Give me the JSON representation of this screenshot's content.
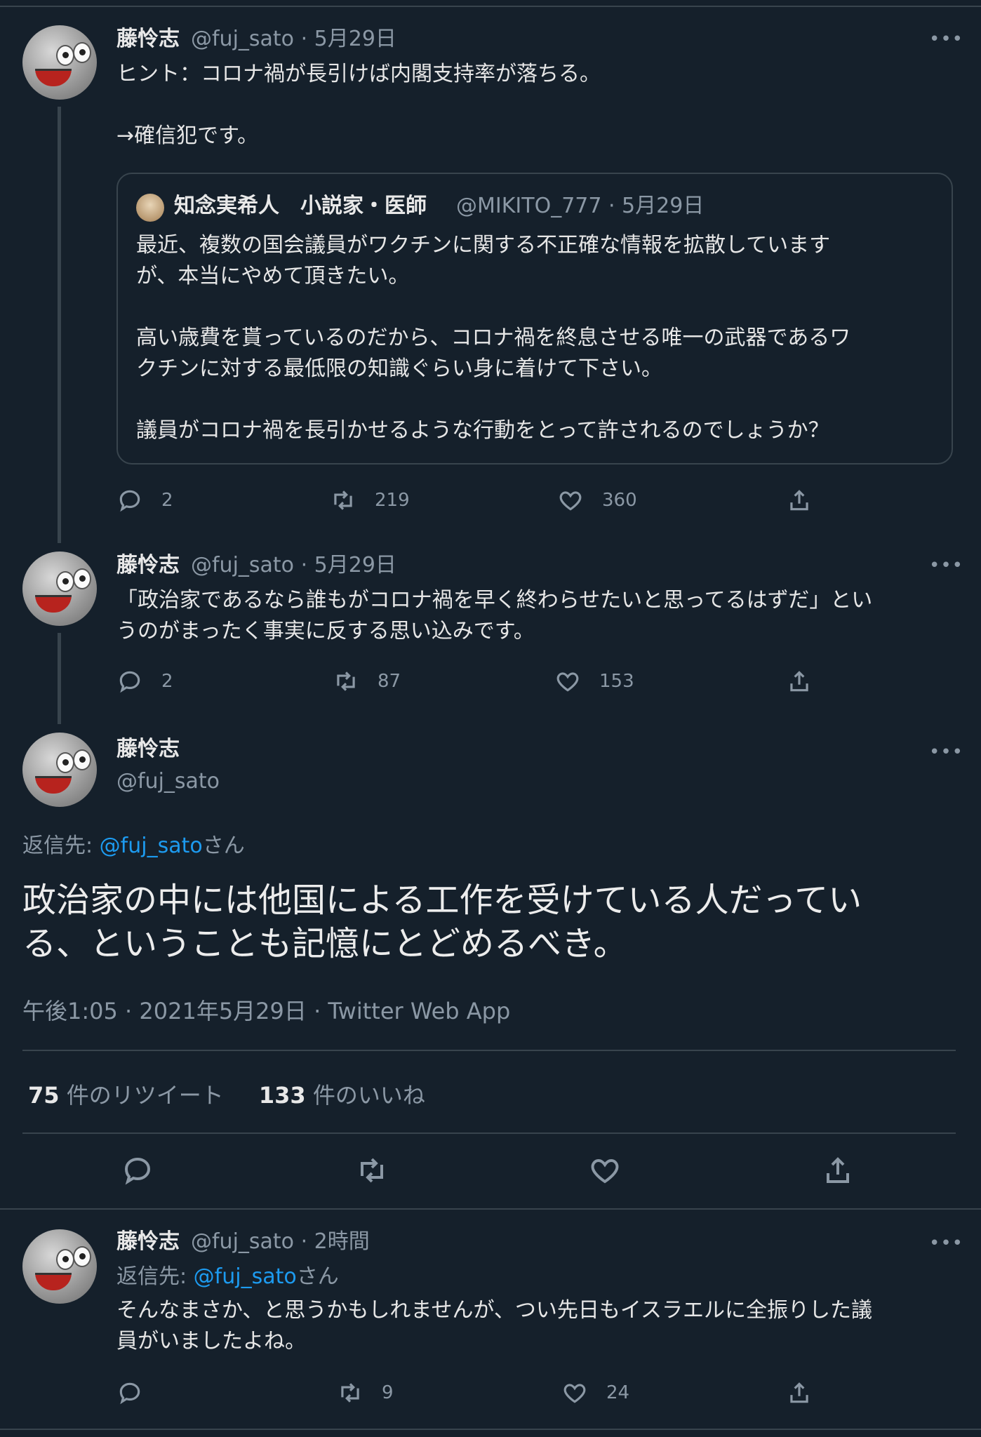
{
  "tweets": [
    {
      "name": "藤怜志",
      "meta": "@fuj_sato · 5月29日",
      "text_lines": [
        "ヒント：コロナ禍が長引けば内閣支持率が落ちる。",
        "",
        "→確信犯です。"
      ],
      "quote": {
        "name": "知念実希人　小説家・医師",
        "meta": "@MIKITO_777 · 5月29日",
        "text": "最近、複数の国会議員がワクチンに関する不正確な情報を拡散しています\nが、本当にやめて頂きたい。\n\n高い歳費を貰っているのだから、コロナ禍を終息させる唯一の武器であるワ\nクチンに対する最低限の知識ぐらい身に着けて下さい。\n\n議員がコロナ禍を長引かせるような行動をとって許されるのでしょうか？"
      },
      "replies": "2",
      "retweets": "219",
      "likes": "360"
    },
    {
      "name": "藤怜志",
      "meta": "@fuj_sato · 5月29日",
      "text": "「政治家であるなら誰もがコロナ禍を早く終わらせたいと思ってるはずだ」とい\nうのがまったく事実に反する思い込みです。",
      "replies": "2",
      "retweets": "87",
      "likes": "153"
    }
  ],
  "focus": {
    "name": "藤怜志",
    "handle": "@fuj_sato",
    "reply_to_prefix": "返信先: ",
    "reply_to_link": "@fuj_sato",
    "reply_to_suffix": "さん",
    "text": "政治家の中には他国による工作を受けている人だってい\nる、ということも記憶にとどめるべき。",
    "timestamp": "午後1:05 · 2021年5月29日 · Twitter Web App",
    "retweet_count": "75",
    "retweet_label": " 件のリツイート",
    "like_count": "133",
    "like_label": " 件のいいね"
  },
  "reply": {
    "name": "藤怜志",
    "meta": "@fuj_sato · 2時間",
    "reply_to_prefix": "返信先: ",
    "reply_to_link": "@fuj_sato",
    "reply_to_suffix": "さん",
    "text": "そんなまさか、と思うかもしれませんが、つい先日もイスラエルに全振りした議\n員がいましたよね。",
    "replies": "",
    "retweets": "9",
    "likes": "24"
  },
  "more_glyph": "•••",
  "colors": {
    "background": "#15202b",
    "link": "#1d9bf0",
    "muted": "#8b98a5",
    "border": "#38444d"
  },
  "icons": [
    "reply-icon",
    "retweet-icon",
    "like-icon",
    "share-icon",
    "more-icon"
  ]
}
